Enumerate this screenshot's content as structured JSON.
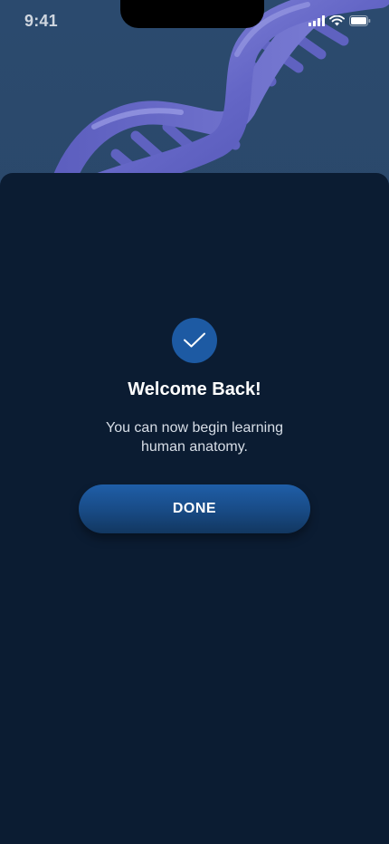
{
  "status_bar": {
    "time": "9:41",
    "icons": [
      "cellular-signal-icon",
      "wifi-icon",
      "battery-icon"
    ]
  },
  "hero": {
    "illustration": "dna-helix"
  },
  "success_sheet": {
    "icon": "checkmark-icon",
    "title": "Welcome Back!",
    "message": "You can now begin learning human anatomy.",
    "done_label": "DONE"
  },
  "colors": {
    "background": "#0b1c32",
    "hero_background": "#2b4a6e",
    "accent": "#1d5aa3",
    "text_primary": "#ffffff",
    "text_secondary": "#d7dee7"
  }
}
